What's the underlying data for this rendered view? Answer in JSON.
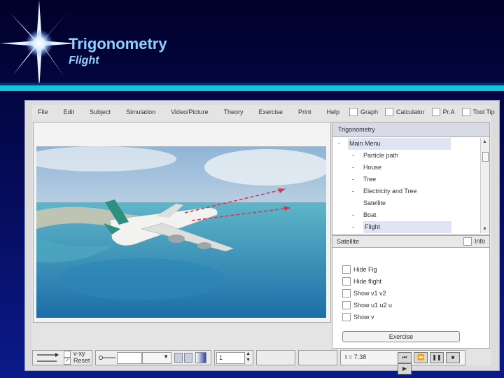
{
  "slide": {
    "title": "Trigonometry",
    "subtitle": "Flight"
  },
  "menu": [
    "File",
    "Edit",
    "Subject",
    "Simulation",
    "Video/Picture",
    "Theory",
    "Exercise",
    "Print",
    "Help"
  ],
  "toolbar": {
    "graph": "Graph",
    "calculator": "Calculator",
    "pra": "Pr.A",
    "tooltip": "Tool Tip"
  },
  "tree": {
    "header": "Trigonometry",
    "root": "Main Menu",
    "items": [
      "Particle path",
      "House",
      "Tree",
      "Electricity and Tree",
      "Satellite",
      "Boat",
      "Flight"
    ]
  },
  "satellite": {
    "title": "Satellite",
    "info": "Info",
    "options": [
      "Hide Fig",
      "Hide flight",
      "Show v1 v2",
      "Show u1 u2 u",
      "Show v"
    ],
    "exercise": "Exercise"
  },
  "bottom": {
    "vxy": "v-xy",
    "reset": "Reset",
    "step_value": "1",
    "time": "t = 7.38"
  },
  "colors": {
    "slide_text": "#8fd0ff",
    "accent_bar": "#15c3d7",
    "arrow": "#e0304a"
  }
}
